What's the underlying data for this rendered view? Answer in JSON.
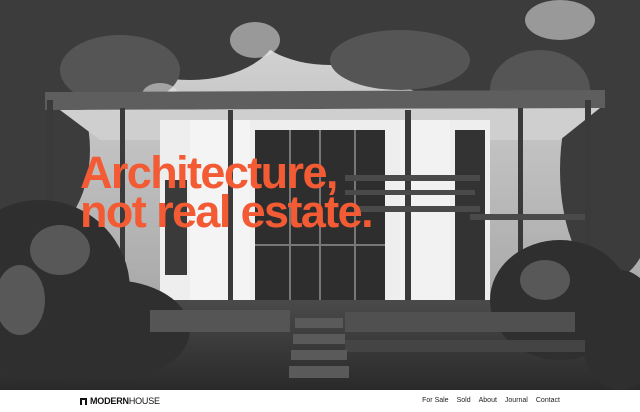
{
  "hero": {
    "headline_line1": "Architecture,",
    "headline_line2": "not real estate.",
    "headline_color": "#f25b34",
    "photo_style": "black-and-white"
  },
  "brand": {
    "logo_part1": "MODERN",
    "logo_part2": "HOUSE",
    "logo_icon": "house-mark-icon"
  },
  "nav": {
    "items": [
      "For Sale",
      "Sold",
      "About",
      "Journal",
      "Contact"
    ]
  }
}
